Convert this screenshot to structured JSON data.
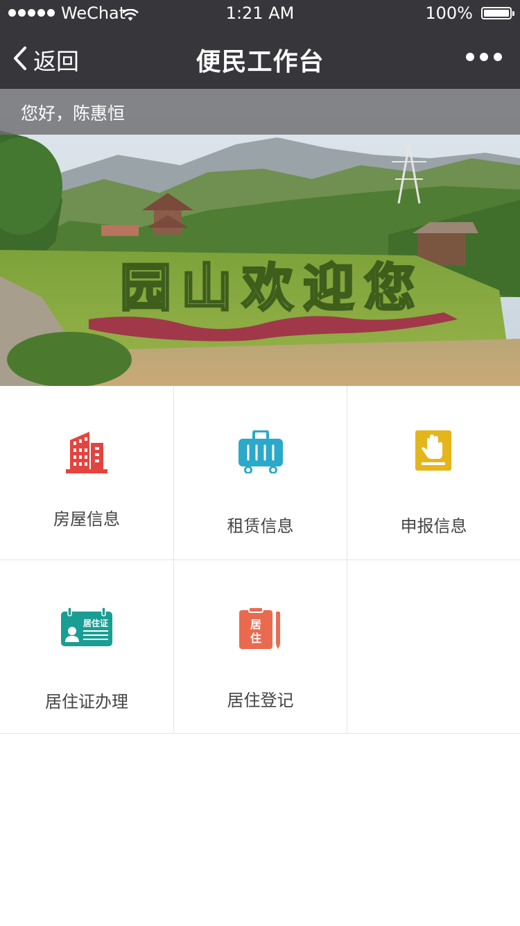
{
  "status_bar": {
    "carrier": "WeChat",
    "time": "1:21 AM",
    "battery": "100%"
  },
  "nav": {
    "back_label": "返回",
    "title": "便民工作台"
  },
  "banner": {
    "greeting": "您好，陈惠恒",
    "hedge_text": "园山欢迎您"
  },
  "menu": {
    "items": [
      {
        "label": "房屋信息",
        "icon": "building-icon",
        "color": "#e4443f"
      },
      {
        "label": "租赁信息",
        "icon": "suitcase-icon",
        "color": "#2ba9c9"
      },
      {
        "label": "申报信息",
        "icon": "hand-report-icon",
        "color": "#e5b51c"
      },
      {
        "label": "居住证办理",
        "icon": "residence-card-icon",
        "color": "#1a9e94",
        "icon_text": "居住证"
      },
      {
        "label": "居住登记",
        "icon": "residence-register-icon",
        "color": "#ea6a50",
        "icon_text_top": "居",
        "icon_text_bottom": "住"
      }
    ]
  }
}
